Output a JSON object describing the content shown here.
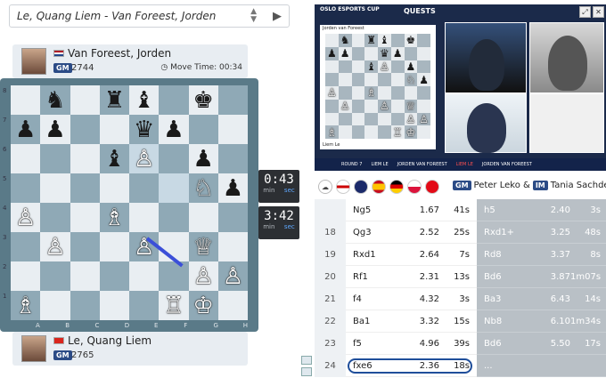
{
  "game_select": {
    "value": "Le, Quang Liem - Van Foreest, Jorden"
  },
  "top_player": {
    "name": "Van Foreest, Jorden",
    "title": "GM",
    "rating": "2744",
    "move_time_label": "Move Time: 00:34"
  },
  "bottom_player": {
    "name": "Le, Quang Liem",
    "title": "GM",
    "rating": "2765"
  },
  "clocks": {
    "top": {
      "time": "0:43",
      "unit_min": "min",
      "unit_sec": "sec"
    },
    "bottom": {
      "time": "3:42",
      "unit_min": "min",
      "unit_sec": "sec"
    }
  },
  "board": {
    "ranks": [
      "8",
      "7",
      "6",
      "5",
      "4",
      "3",
      "2",
      "1"
    ],
    "files": [
      "A",
      "B",
      "C",
      "D",
      "E",
      "F",
      "G",
      "H"
    ],
    "position": [
      [
        "",
        "♞",
        "",
        "♜",
        "♝",
        "",
        "♚",
        ""
      ],
      [
        "♟",
        "♟",
        "",
        "",
        "♛",
        "♟",
        "",
        ""
      ],
      [
        "",
        "",
        "",
        "♝",
        "♙",
        "",
        "♟",
        ""
      ],
      [
        "",
        "",
        "",
        "",
        "",
        "",
        "♘",
        "♟"
      ],
      [
        "♙",
        "",
        "",
        "♗",
        "",
        "",
        "",
        ""
      ],
      [
        "",
        "♙",
        "",
        "",
        "♙",
        "",
        "♕",
        ""
      ],
      [
        "",
        "",
        "",
        "",
        "",
        "",
        "♙",
        "♙"
      ],
      [
        "♗",
        "",
        "",
        "",
        "",
        "♖",
        "♔",
        ""
      ]
    ],
    "colors": [
      [
        "",
        "b",
        "",
        "b",
        "b",
        "",
        "b",
        ""
      ],
      [
        "b",
        "b",
        "",
        "",
        "b",
        "b",
        "",
        ""
      ],
      [
        "",
        "",
        "",
        "b",
        "w",
        "",
        "b",
        ""
      ],
      [
        "",
        "",
        "",
        "",
        "",
        "",
        "w",
        "b"
      ],
      [
        "w",
        "",
        "",
        "w",
        "",
        "",
        "",
        ""
      ],
      [
        "",
        "w",
        "",
        "",
        "w",
        "",
        "w",
        ""
      ],
      [
        "",
        "",
        "",
        "",
        "",
        "",
        "w",
        "w"
      ],
      [
        "w",
        "",
        "",
        "",
        "",
        "w",
        "w",
        ""
      ]
    ]
  },
  "video": {
    "brand": "OSLO ESPORTS CUP",
    "title": "QUESTS",
    "mini_board_top": "Jorden van Foreest",
    "mini_board_bottom": "Liem Le",
    "ticker": [
      "ROUND 7",
      "LIEM LE",
      "JORDEN VAN FOREEST",
      "LIEM LE",
      "JORDEN VAN FOREEST"
    ]
  },
  "commentary": {
    "c1_title": "GM",
    "c1_name": "Peter Leko &",
    "c2_title": "IM",
    "c2_name": "Tania Sachdev"
  },
  "moves": [
    {
      "num": "",
      "w": "Ng5",
      "we": "1.67",
      "wt": "41s",
      "b": "h5",
      "be": "2.40",
      "bt": "3s"
    },
    {
      "num": "18",
      "w": "Qg3",
      "we": "2.52",
      "wt": "25s",
      "b": "Rxd1+",
      "be": "3.25",
      "bt": "48s"
    },
    {
      "num": "19",
      "w": "Rxd1",
      "we": "2.64",
      "wt": "7s",
      "b": "Rd8",
      "be": "3.37",
      "bt": "8s"
    },
    {
      "num": "20",
      "w": "Rf1",
      "we": "2.31",
      "wt": "13s",
      "b": "Bd6",
      "be": "3.87",
      "bt": "1m07s"
    },
    {
      "num": "21",
      "w": "f4",
      "we": "4.32",
      "wt": "3s",
      "b": "Ba3",
      "be": "6.43",
      "bt": "14s"
    },
    {
      "num": "22",
      "w": "Ba1",
      "we": "3.32",
      "wt": "15s",
      "b": "Nb8",
      "be": "6.10",
      "bt": "1m34s"
    },
    {
      "num": "23",
      "w": "f5",
      "we": "4.96",
      "wt": "39s",
      "b": "Bd6",
      "be": "5.50",
      "bt": "17s"
    },
    {
      "num": "24",
      "w": "fxe6",
      "we": "2.36",
      "wt": "18s",
      "b": "...",
      "be": "",
      "bt": ""
    }
  ],
  "colors": {
    "accent": "#2b4b86",
    "board_dark": "#8fa9b6",
    "board_light": "#e9eef2",
    "arrow": "#3b4fd8"
  }
}
